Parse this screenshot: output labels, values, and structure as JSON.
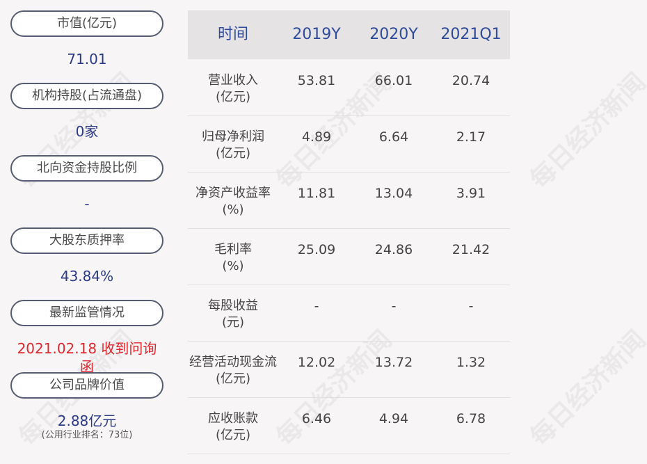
{
  "watermark": "每日经济新闻",
  "left": {
    "items": [
      {
        "label": "市值(亿元)",
        "value": "71.01"
      },
      {
        "label": "机构持股(占流通盘)",
        "value": "0家"
      },
      {
        "label": "北向资金持股比例",
        "value": "-"
      },
      {
        "label": "大股东质押率",
        "value": "43.84%"
      },
      {
        "label": "最新监管情况",
        "value": "2021.02.18 收到问询函"
      },
      {
        "label": "公司品牌价值",
        "value": "2.88亿元",
        "note": "(公用行业排名：73位)"
      }
    ]
  },
  "table": {
    "headers": [
      "时间",
      "2019Y",
      "2020Y",
      "2021Q1"
    ],
    "rows": [
      {
        "label1": "营业收入",
        "label2": "(亿元)",
        "v": [
          "53.81",
          "66.01",
          "20.74"
        ]
      },
      {
        "label1": "归母净利润",
        "label2": "(亿元)",
        "v": [
          "4.89",
          "6.64",
          "2.17"
        ]
      },
      {
        "label1": "净资产收益率",
        "label2": "(%)",
        "v": [
          "11.81",
          "13.04",
          "3.91"
        ]
      },
      {
        "label1": "毛利率",
        "label2": "(%)",
        "v": [
          "25.09",
          "24.86",
          "21.42"
        ]
      },
      {
        "label1": "每股收益",
        "label2": "(元)",
        "v": [
          "-",
          "-",
          "-"
        ]
      },
      {
        "label1": "经营活动现金流",
        "label2": "(亿元)",
        "v": [
          "12.02",
          "13.72",
          "1.32"
        ]
      },
      {
        "label1": "应收账款",
        "label2": "(亿元)",
        "v": [
          "6.46",
          "4.94",
          "6.78"
        ]
      }
    ]
  }
}
